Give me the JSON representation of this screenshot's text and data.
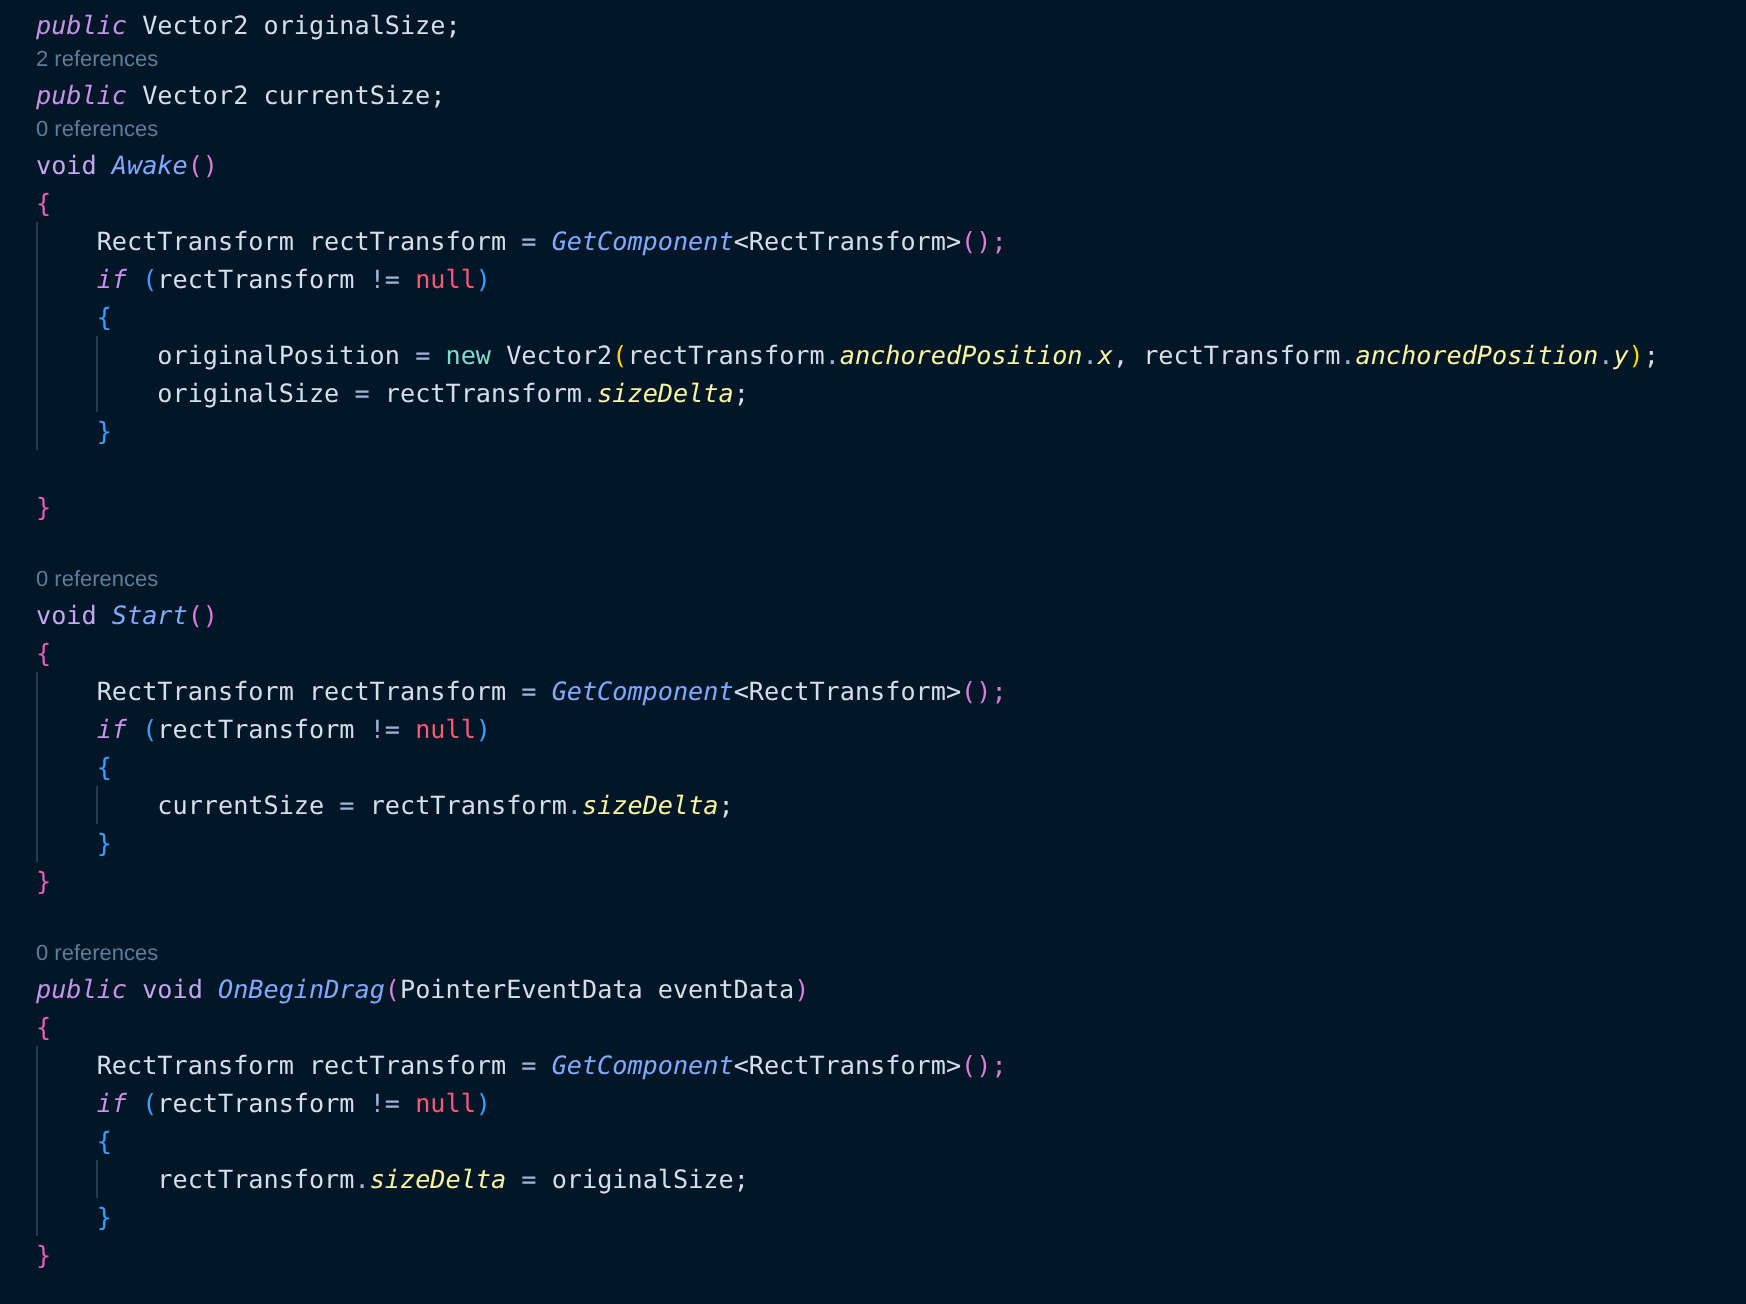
{
  "editor": {
    "lines": [
      {
        "kind": "code",
        "tokens": [
          {
            "t": "public",
            "kind": "kw"
          },
          {
            "t": " Vector2 originalSize;",
            "kind": "plain"
          }
        ]
      },
      {
        "kind": "lens",
        "text": "2 references"
      },
      {
        "kind": "code",
        "tokens": [
          {
            "t": "public",
            "kind": "kw"
          },
          {
            "t": " Vector2 currentSize;",
            "kind": "plain"
          }
        ]
      },
      {
        "kind": "lens",
        "text": "0 references"
      },
      {
        "kind": "code",
        "tokens": [
          {
            "t": "void ",
            "kind": "type"
          },
          {
            "t": "Awake",
            "kind": "fn"
          },
          {
            "t": "()",
            "kind": "paren"
          }
        ]
      },
      {
        "kind": "code",
        "tokens": [
          {
            "t": "{",
            "kind": "brace1"
          }
        ]
      },
      {
        "kind": "code",
        "tokens": [
          {
            "t": "    RectTransform rectTransform ",
            "kind": "plain"
          },
          {
            "t": "= ",
            "kind": "op"
          },
          {
            "t": "GetComponent",
            "kind": "fn"
          },
          {
            "t": "<RectTransform>",
            "kind": "plain"
          },
          {
            "t": "();",
            "kind": "paren"
          }
        ]
      },
      {
        "kind": "code",
        "tokens": [
          {
            "t": "    if ",
            "kind": "kw"
          },
          {
            "t": "(",
            "kind": "brace2"
          },
          {
            "t": "rectTransform ",
            "kind": "plain"
          },
          {
            "t": "!= ",
            "kind": "op"
          },
          {
            "t": "null",
            "kind": "null"
          },
          {
            "t": ")",
            "kind": "brace2"
          }
        ]
      },
      {
        "kind": "code",
        "tokens": [
          {
            "t": "    {",
            "kind": "brace2"
          }
        ]
      },
      {
        "kind": "code",
        "tokens": [
          {
            "t": "        originalPosition ",
            "kind": "plain"
          },
          {
            "t": "= ",
            "kind": "op"
          },
          {
            "t": "new",
            "kind": "new"
          },
          {
            "t": " Vector2",
            "kind": "plain"
          },
          {
            "t": "(",
            "kind": "brace3"
          },
          {
            "t": "rectTransform",
            "kind": "plain"
          },
          {
            "t": ".",
            "kind": "op"
          },
          {
            "t": "anchoredPosition",
            "kind": "prop"
          },
          {
            "t": ".",
            "kind": "op"
          },
          {
            "t": "x",
            "kind": "prop"
          },
          {
            "t": ", rectTransform",
            "kind": "plain"
          },
          {
            "t": ".",
            "kind": "op"
          },
          {
            "t": "anchoredPosition",
            "kind": "prop"
          },
          {
            "t": ".",
            "kind": "op"
          },
          {
            "t": "y",
            "kind": "prop"
          },
          {
            "t": ")",
            "kind": "brace3"
          },
          {
            "t": ";",
            "kind": "plain"
          }
        ]
      },
      {
        "kind": "code",
        "tokens": [
          {
            "t": "        originalSize ",
            "kind": "plain"
          },
          {
            "t": "=",
            "kind": "op"
          },
          {
            "t": " rectTransform",
            "kind": "plain"
          },
          {
            "t": ".",
            "kind": "op"
          },
          {
            "t": "sizeDelta",
            "kind": "prop"
          },
          {
            "t": ";",
            "kind": "plain"
          }
        ]
      },
      {
        "kind": "code",
        "tokens": [
          {
            "t": "    }",
            "kind": "brace2"
          }
        ]
      },
      {
        "kind": "blank"
      },
      {
        "kind": "code",
        "tokens": [
          {
            "t": "}",
            "kind": "brace1"
          }
        ]
      },
      {
        "kind": "blank"
      },
      {
        "kind": "lens",
        "text": "0 references"
      },
      {
        "kind": "code",
        "tokens": [
          {
            "t": "void ",
            "kind": "type"
          },
          {
            "t": "Start",
            "kind": "fn"
          },
          {
            "t": "()",
            "kind": "paren"
          }
        ]
      },
      {
        "kind": "code",
        "tokens": [
          {
            "t": "{",
            "kind": "brace1"
          }
        ]
      },
      {
        "kind": "code",
        "tokens": [
          {
            "t": "    RectTransform rectTransform ",
            "kind": "plain"
          },
          {
            "t": "= ",
            "kind": "op"
          },
          {
            "t": "GetComponent",
            "kind": "fn"
          },
          {
            "t": "<RectTransform>",
            "kind": "plain"
          },
          {
            "t": "();",
            "kind": "paren"
          }
        ]
      },
      {
        "kind": "code",
        "tokens": [
          {
            "t": "    if ",
            "kind": "kw"
          },
          {
            "t": "(",
            "kind": "brace2"
          },
          {
            "t": "rectTransform ",
            "kind": "plain"
          },
          {
            "t": "!= ",
            "kind": "op"
          },
          {
            "t": "null",
            "kind": "null"
          },
          {
            "t": ")",
            "kind": "brace2"
          }
        ]
      },
      {
        "kind": "code",
        "tokens": [
          {
            "t": "    {",
            "kind": "brace2"
          }
        ]
      },
      {
        "kind": "code",
        "tokens": [
          {
            "t": "        currentSize ",
            "kind": "plain"
          },
          {
            "t": "=",
            "kind": "op"
          },
          {
            "t": " rectTransform",
            "kind": "plain"
          },
          {
            "t": ".",
            "kind": "op"
          },
          {
            "t": "sizeDelta",
            "kind": "prop"
          },
          {
            "t": ";",
            "kind": "plain"
          }
        ]
      },
      {
        "kind": "code",
        "tokens": [
          {
            "t": "    }",
            "kind": "brace2"
          }
        ]
      },
      {
        "kind": "code",
        "tokens": [
          {
            "t": "}",
            "kind": "brace1"
          }
        ]
      },
      {
        "kind": "blank"
      },
      {
        "kind": "lens",
        "text": "0 references"
      },
      {
        "kind": "code",
        "tokens": [
          {
            "t": "public ",
            "kind": "kw"
          },
          {
            "t": "void ",
            "kind": "type"
          },
          {
            "t": "OnBeginDrag",
            "kind": "fn"
          },
          {
            "t": "(",
            "kind": "paren"
          },
          {
            "t": "PointerEventData eventData",
            "kind": "plain"
          },
          {
            "t": ")",
            "kind": "paren"
          }
        ]
      },
      {
        "kind": "code",
        "tokens": [
          {
            "t": "{",
            "kind": "brace1"
          }
        ]
      },
      {
        "kind": "code",
        "tokens": [
          {
            "t": "    RectTransform rectTransform ",
            "kind": "plain"
          },
          {
            "t": "= ",
            "kind": "op"
          },
          {
            "t": "GetComponent",
            "kind": "fn"
          },
          {
            "t": "<RectTransform>",
            "kind": "plain"
          },
          {
            "t": "();",
            "kind": "paren"
          }
        ]
      },
      {
        "kind": "code",
        "tokens": [
          {
            "t": "    if ",
            "kind": "kw"
          },
          {
            "t": "(",
            "kind": "brace2"
          },
          {
            "t": "rectTransform ",
            "kind": "plain"
          },
          {
            "t": "!= ",
            "kind": "op"
          },
          {
            "t": "null",
            "kind": "null"
          },
          {
            "t": ")",
            "kind": "brace2"
          }
        ]
      },
      {
        "kind": "code",
        "tokens": [
          {
            "t": "    {",
            "kind": "brace2"
          }
        ]
      },
      {
        "kind": "code",
        "tokens": [
          {
            "t": "        rectTransform",
            "kind": "plain"
          },
          {
            "t": ".",
            "kind": "op"
          },
          {
            "t": "sizeDelta",
            "kind": "prop"
          },
          {
            "t": " =",
            "kind": "op"
          },
          {
            "t": " originalSize;",
            "kind": "plain"
          }
        ]
      },
      {
        "kind": "code",
        "tokens": [
          {
            "t": "    }",
            "kind": "brace2"
          }
        ]
      },
      {
        "kind": "code",
        "tokens": [
          {
            "t": "}",
            "kind": "brace1"
          }
        ]
      }
    ]
  }
}
